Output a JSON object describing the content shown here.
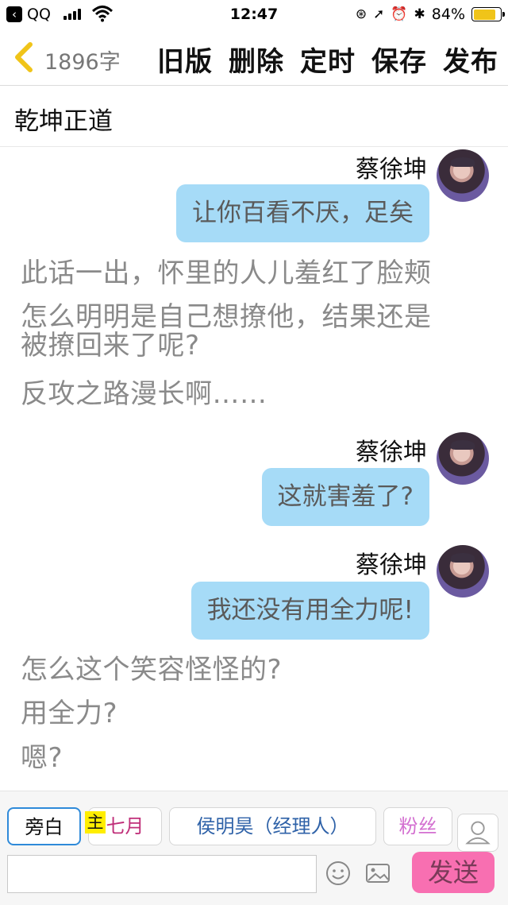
{
  "status_bar": {
    "back_glyph": "‹",
    "carrier": "QQ",
    "time": "12:47",
    "right_glyphs": [
      "⊛",
      "➚",
      "⏰",
      "✱"
    ],
    "battery": "84%",
    "battery_level": 0.84
  },
  "nav": {
    "word_count": "1896字",
    "actions": [
      "旧版",
      "删除",
      "定时",
      "保存",
      "发布"
    ]
  },
  "title": "乾坤正道",
  "messages": [
    {
      "speaker": "蔡徐坤",
      "text": "让你百看不厌，足矣"
    },
    {
      "speaker": "蔡徐坤",
      "text": "这就害羞了?"
    },
    {
      "speaker": "蔡徐坤",
      "text": "我还没有用全力呢!"
    }
  ],
  "narration": {
    "n1": "此话一出，怀里的人儿羞红了脸颊",
    "n2a": "怎么明明是自己想撩他，结果还是",
    "n2b": "被撩回来了呢?",
    "n3": "反攻之路漫长啊……",
    "n4": "怎么这个笑容怪怪的?",
    "n5": "用全力?",
    "n6": "嗯?"
  },
  "roles": {
    "narrator": "旁白",
    "host_badge": "主",
    "r1": "七月",
    "r2": "侯明昊（经理人）",
    "r3": "粉丝"
  },
  "input": {
    "placeholder": "",
    "send_label": "发送"
  },
  "colors": {
    "bubble": "#a6dbf7",
    "send": "#f86fb1",
    "role_qiyue": "#c0307a",
    "role_fans": "#d36fd0",
    "role_hou": "#2f62a8",
    "selected_border": "#2f8ad9",
    "host_badge": "#ffee00",
    "battery": "#f0c419"
  },
  "icons": [
    "back-icon",
    "wifi-icon",
    "signal-icon",
    "battery-icon",
    "avatar",
    "person-icon",
    "emoji-icon",
    "image-icon"
  ]
}
